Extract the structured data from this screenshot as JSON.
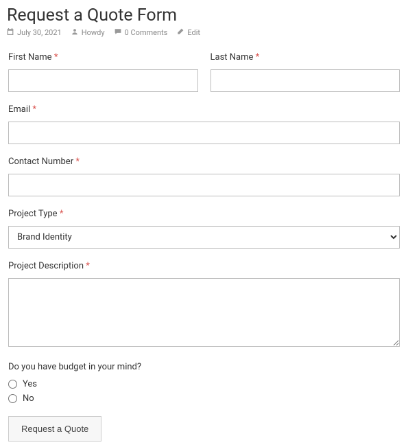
{
  "header": {
    "title": "Request a Quote Form",
    "date": "July 30, 2021",
    "author": "Howdy",
    "comments": "0 Comments",
    "edit": "Edit"
  },
  "form": {
    "first_name_label": "First Name",
    "last_name_label": "Last Name",
    "email_label": "Email",
    "contact_label": "Contact Number",
    "project_type_label": "Project Type",
    "project_type_value": "Brand Identity",
    "project_desc_label": "Project Description",
    "budget_label": "Do you have budget in your mind?",
    "budget_yes": "Yes",
    "budget_no": "No",
    "submit_label": "Request a Quote",
    "required_marker": "*"
  }
}
